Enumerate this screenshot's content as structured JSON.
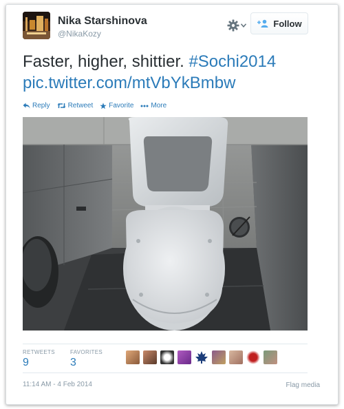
{
  "user": {
    "display_name": "Nika Starshinova",
    "handle": "@NikaKozy"
  },
  "follow_button": {
    "label": "Follow"
  },
  "tweet": {
    "text": "Faster, higher, shittier. ",
    "hashtag": "#Sochi2014",
    "pic_link": "pic.twitter.com/mtVbYkBmbw"
  },
  "actions": {
    "reply": "Reply",
    "retweet": "Retweet",
    "favorite": "Favorite",
    "more": "More"
  },
  "stats": {
    "retweets_label": "RETWEETS",
    "retweets_count": "9",
    "favorites_label": "FAVORITES",
    "favorites_count": "3"
  },
  "footer": {
    "timestamp": "11:14 AM - 4 Feb 2014",
    "flag_media": "Flag media"
  },
  "colors": {
    "link": "#2b7bb9",
    "muted": "#8899a6",
    "text": "#292f33"
  },
  "icons": [
    "gear-icon",
    "chevron-down-icon",
    "add-user-icon",
    "reply-icon",
    "retweet-icon",
    "star-icon",
    "more-icon"
  ]
}
